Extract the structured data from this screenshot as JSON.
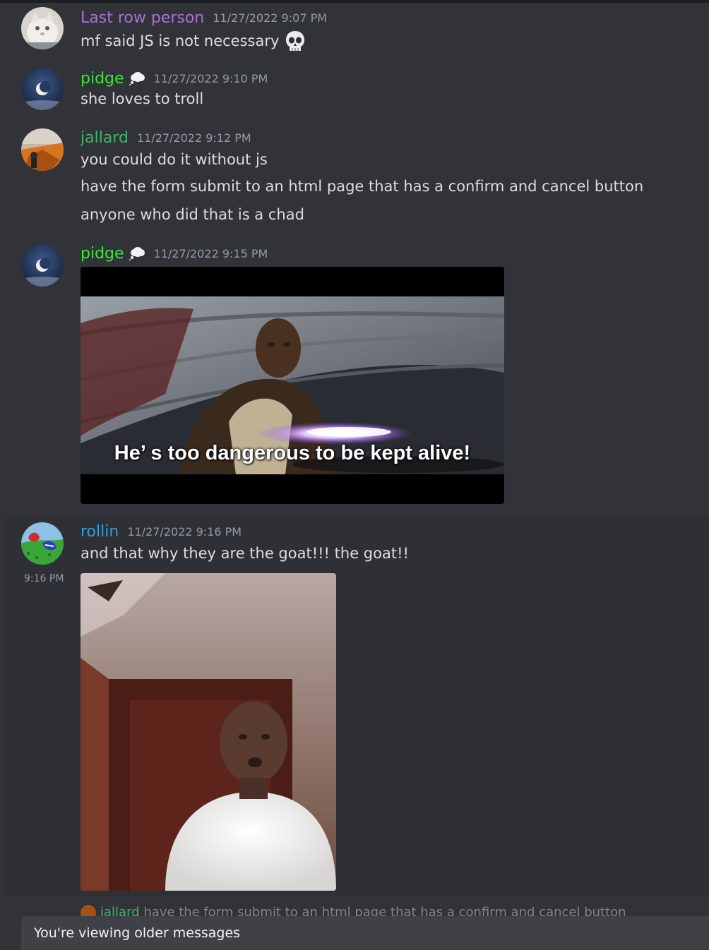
{
  "messages": [
    {
      "username": "Last row person",
      "user_color": "#a970d6",
      "timestamp": "11/27/2022 9:07 PM",
      "lines": [
        "mf said JS is not necessary"
      ],
      "trailing_icon": "skull-emoji"
    },
    {
      "username": "pidge",
      "user_color": "#3be635",
      "timestamp": "11/27/2022 9:10 PM",
      "status_icon": "thought-bubble-icon",
      "lines": [
        "she loves to troll"
      ]
    },
    {
      "username": "jallard",
      "user_color": "#3fb56c",
      "timestamp": "11/27/2022 9:12 PM",
      "lines": [
        "you could do it without js",
        "have the form submit to an html page that has a confirm and cancel button",
        "anyone who did that is a chad"
      ]
    },
    {
      "username": "pidge",
      "user_color": "#3be635",
      "timestamp": "11/27/2022 9:15 PM",
      "status_icon": "thought-bubble-icon",
      "attachment": {
        "type": "gif",
        "caption": "He’ s too dangerous to be kept alive!"
      }
    },
    {
      "username": "rollin",
      "user_color": "#3a9bd9",
      "timestamp": "11/27/2022 9:16 PM",
      "lines": [
        "and that why they are the goat!!! the goat!!"
      ],
      "attachment": {
        "type": "gif"
      },
      "hover_time": "9:16 PM"
    }
  ],
  "reply_preview": {
    "username": "jallard",
    "text": "have the form submit to an html page that has a confirm and cancel button"
  },
  "older_banner": "You're viewing older messages"
}
